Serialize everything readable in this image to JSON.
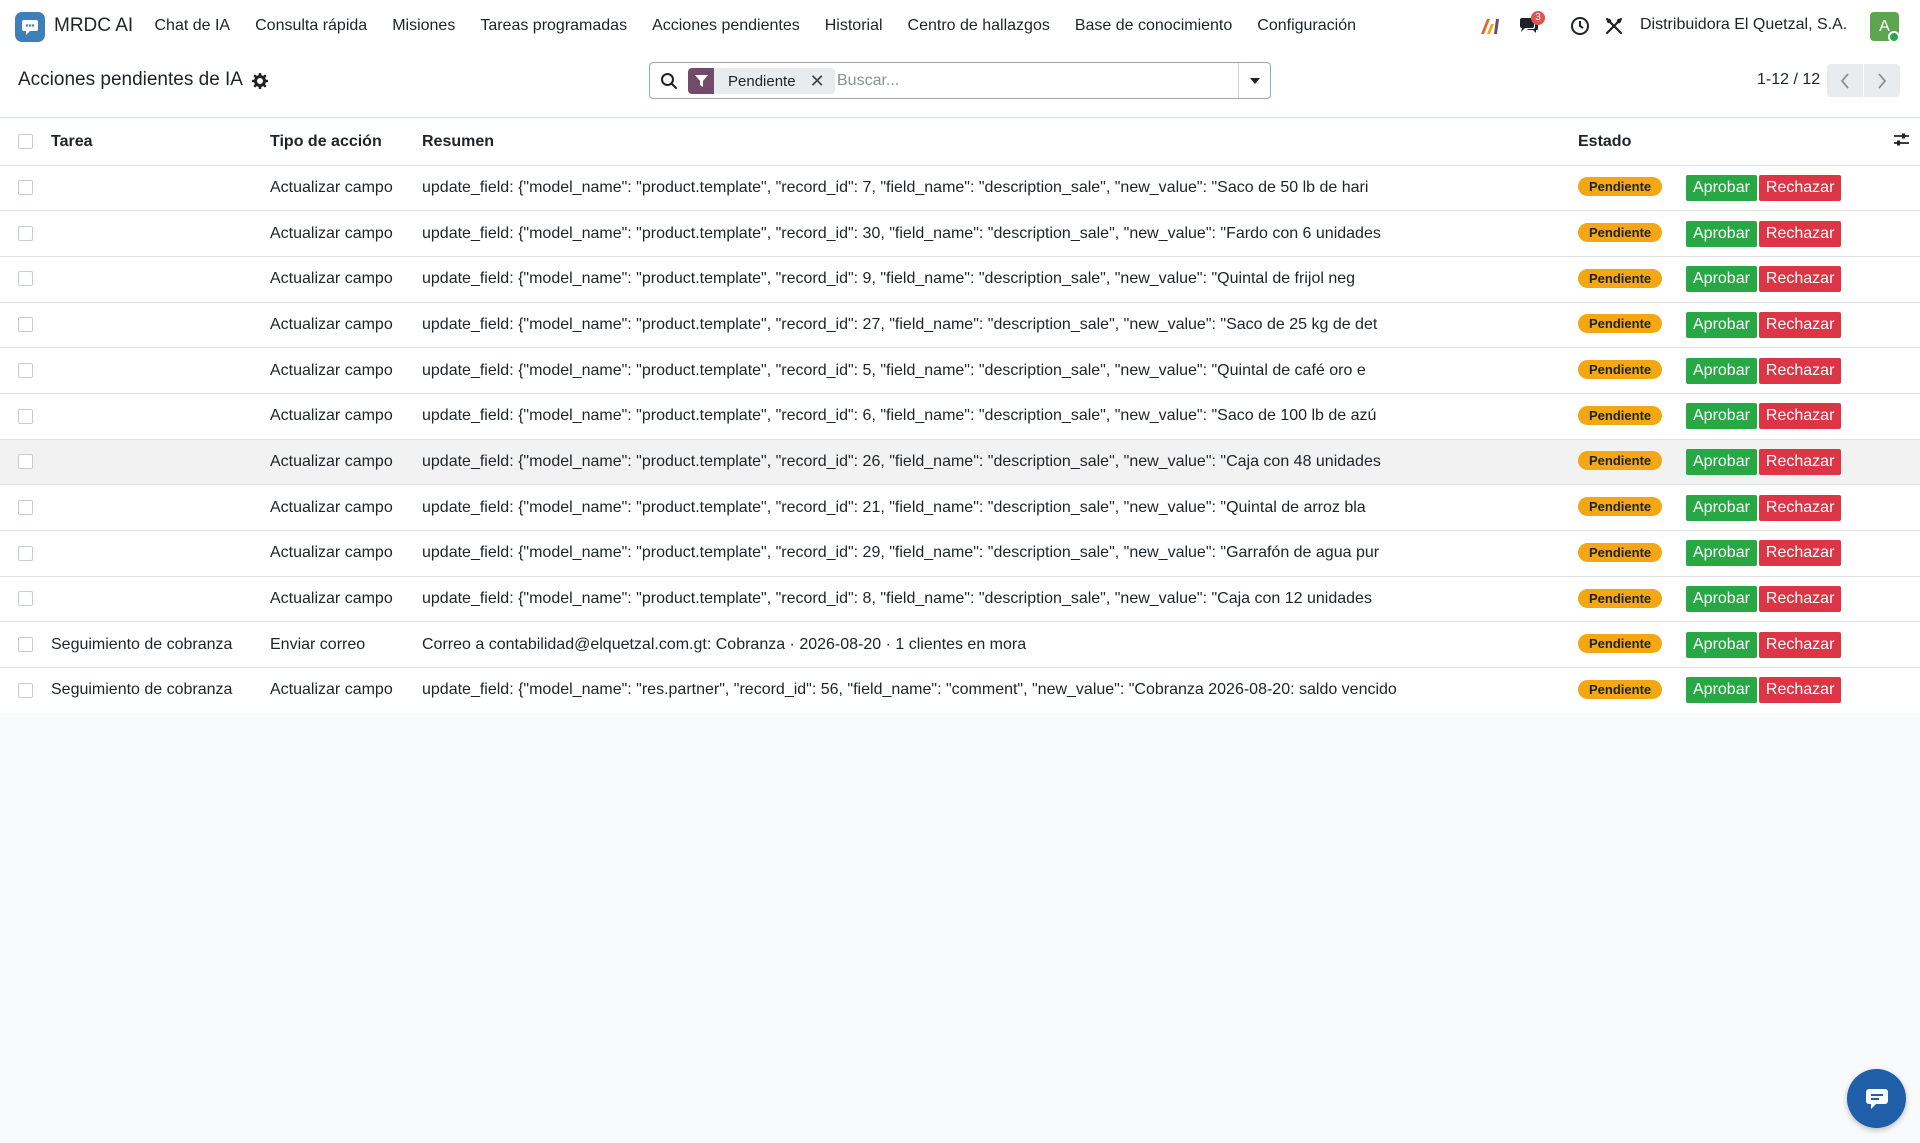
{
  "navbar": {
    "app_name": "MRDC AI",
    "menu": [
      "Chat de IA",
      "Consulta rápida",
      "Misiones",
      "Tareas programadas",
      "Acciones pendientes",
      "Historial",
      "Centro de hallazgos",
      "Base de conocimiento",
      "Configuración"
    ],
    "messages_count": "3",
    "company": "Distribuidora El Quetzal, S.A.",
    "avatar_letter": "A",
    "icons": [
      "ai-logo-icon",
      "messages-icon",
      "activity-clock-icon",
      "tools-icon"
    ]
  },
  "control_panel": {
    "title": "Acciones pendientes de IA",
    "search": {
      "facet": "Pendiente",
      "placeholder": "Buscar..."
    },
    "pager": "1-12 / 12"
  },
  "table": {
    "headers": {
      "task": "Tarea",
      "action_type": "Tipo de acción",
      "summary": "Resumen",
      "status": "Estado"
    },
    "approve_label": "Aprobar",
    "reject_label": "Rechazar",
    "rows": [
      {
        "task": "",
        "action_type": "Actualizar campo",
        "summary": "update_field: {\"model_name\": \"product.template\", \"record_id\": 7, \"field_name\": \"description_sale\", \"new_value\": \"Saco de 50 lb de hari",
        "status": "Pendiente"
      },
      {
        "task": "",
        "action_type": "Actualizar campo",
        "summary": "update_field: {\"model_name\": \"product.template\", \"record_id\": 30, \"field_name\": \"description_sale\", \"new_value\": \"Fardo con 6 unidades",
        "status": "Pendiente"
      },
      {
        "task": "",
        "action_type": "Actualizar campo",
        "summary": "update_field: {\"model_name\": \"product.template\", \"record_id\": 9, \"field_name\": \"description_sale\", \"new_value\": \"Quintal de frijol neg",
        "status": "Pendiente"
      },
      {
        "task": "",
        "action_type": "Actualizar campo",
        "summary": "update_field: {\"model_name\": \"product.template\", \"record_id\": 27, \"field_name\": \"description_sale\", \"new_value\": \"Saco de 25 kg de det",
        "status": "Pendiente"
      },
      {
        "task": "",
        "action_type": "Actualizar campo",
        "summary": "update_field: {\"model_name\": \"product.template\", \"record_id\": 5, \"field_name\": \"description_sale\", \"new_value\": \"Quintal de café oro e",
        "status": "Pendiente"
      },
      {
        "task": "",
        "action_type": "Actualizar campo",
        "summary": "update_field: {\"model_name\": \"product.template\", \"record_id\": 6, \"field_name\": \"description_sale\", \"new_value\": \"Saco de 100 lb de azú",
        "status": "Pendiente"
      },
      {
        "task": "",
        "action_type": "Actualizar campo",
        "summary": "update_field: {\"model_name\": \"product.template\", \"record_id\": 26, \"field_name\": \"description_sale\", \"new_value\": \"Caja con 48 unidades",
        "status": "Pendiente"
      },
      {
        "task": "",
        "action_type": "Actualizar campo",
        "summary": "update_field: {\"model_name\": \"product.template\", \"record_id\": 21, \"field_name\": \"description_sale\", \"new_value\": \"Quintal de arroz bla",
        "status": "Pendiente"
      },
      {
        "task": "",
        "action_type": "Actualizar campo",
        "summary": "update_field: {\"model_name\": \"product.template\", \"record_id\": 29, \"field_name\": \"description_sale\", \"new_value\": \"Garrafón de agua pur",
        "status": "Pendiente"
      },
      {
        "task": "",
        "action_type": "Actualizar campo",
        "summary": "update_field: {\"model_name\": \"product.template\", \"record_id\": 8, \"field_name\": \"description_sale\", \"new_value\": \"Caja con 12 unidades",
        "status": "Pendiente"
      },
      {
        "task": "Seguimiento de cobranza",
        "action_type": "Enviar correo",
        "summary": "Correo a contabilidad@elquetzal.com.gt: Cobranza · 2026-08-20 · 1 clientes en mora",
        "status": "Pendiente"
      },
      {
        "task": "Seguimiento de cobranza",
        "action_type": "Actualizar campo",
        "summary": "update_field: {\"model_name\": \"res.partner\", \"record_id\": 56, \"field_name\": \"comment\", \"new_value\": \"Cobranza 2026-08-20: saldo vencido",
        "status": "Pendiente"
      }
    ]
  },
  "colors": {
    "approve": "#28a745",
    "reject": "#dc3545",
    "status_pending": "#f3a712",
    "facet_icon": "#714b67",
    "brand": "#3f7fb8"
  }
}
